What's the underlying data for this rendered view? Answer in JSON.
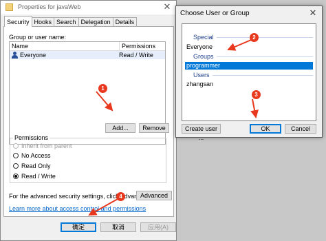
{
  "props_dialog": {
    "title": "Properties for javaWeb",
    "tabs": [
      "Security",
      "Hooks",
      "Search",
      "Delegation",
      "Details"
    ],
    "group_label": "Group or user name:",
    "columns": [
      "Name",
      "Permissions"
    ],
    "rows": [
      {
        "name": "Everyone",
        "permissions": "Read / Write"
      }
    ],
    "add_button": "Add...",
    "remove_button": "Remove",
    "permissions_legend": "Permissions",
    "permission_options": [
      "Inherit from parent",
      "No Access",
      "Read Only",
      "Read / Write"
    ],
    "selected_permission": "Read / Write",
    "advanced_text": "For the advanced security settings, click Advanced.",
    "advanced_button": "Advanced",
    "learn_link": "Learn more about access control and permissions",
    "ok_button": "确定",
    "cancel_button": "取消",
    "apply_button": "应用(A)"
  },
  "chooser_dialog": {
    "title": "Choose User or Group",
    "categories": {
      "special": "Special",
      "groups": "Groups",
      "users": "Users"
    },
    "special_items": [
      "Everyone"
    ],
    "group_items": [
      "programmer"
    ],
    "user_items": [
      "zhangsan"
    ],
    "selected_item": "programmer",
    "create_user_button": "Create user ...",
    "ok_button": "OK",
    "cancel_button": "Cancel"
  },
  "markers": [
    "1",
    "2",
    "3",
    "4"
  ],
  "colors": {
    "accent": "#0078d7",
    "marker": "#e8381e",
    "link": "#0066cc"
  }
}
